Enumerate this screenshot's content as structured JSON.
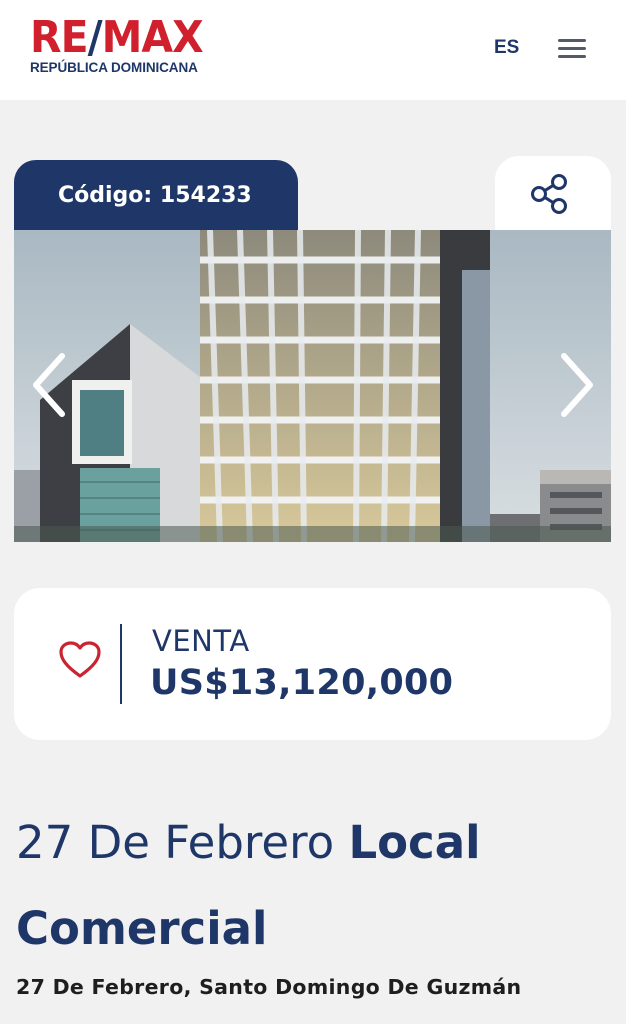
{
  "header": {
    "logo_text": "RE/MAX",
    "logo_subtitle": "REPÚBLICA DOMINICANA",
    "language": "ES",
    "menu_icon": "hamburger-menu-icon"
  },
  "listing": {
    "code_label": "Código:",
    "code_value": "154233",
    "share_icon": "share-icon",
    "gallery": {
      "prev_icon": "chevron-left-icon",
      "next_icon": "chevron-right-icon"
    },
    "favorite_icon": "heart-outline-icon",
    "operation": "VENTA",
    "price": "US$13,120,000",
    "title_light": "27 De Febrero",
    "title_bold_1": "Local",
    "title_bold_2": "Comercial",
    "address": "27 De Febrero, Santo Domingo De Guzmán"
  },
  "colors": {
    "brand_red": "#d0202e",
    "brand_blue": "#1f3768",
    "background": "#f1f1f1",
    "card": "#ffffff"
  }
}
